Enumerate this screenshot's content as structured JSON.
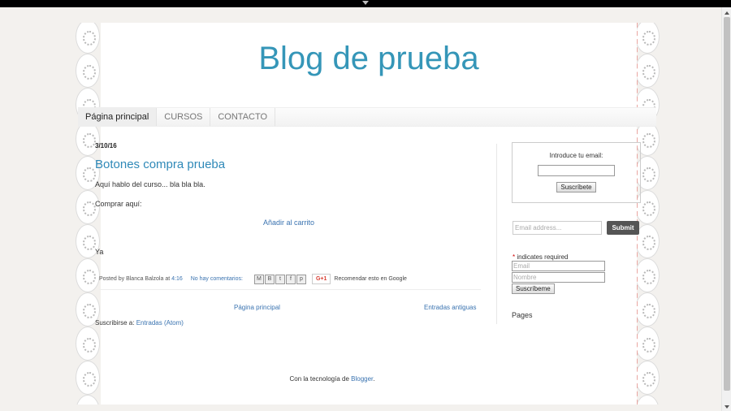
{
  "blog": {
    "title": "Blog de prueba"
  },
  "tabs": [
    {
      "label": "Página principal",
      "active": true
    },
    {
      "label": "CURSOS",
      "active": false
    },
    {
      "label": "CONTACTO",
      "active": false
    }
  ],
  "post": {
    "date": "3/10/16",
    "title": "Botones compra prueba",
    "paragraph1": "Aquí hablo del curso... bla bla bla.",
    "paragraph2": "Comprar aquí:",
    "cart_link": "Añadir al carrito",
    "paragraph3": "Ya",
    "posted_by": "Posted by Blanca Balzola at",
    "time": "4:16",
    "comments": "No hay comentarios:",
    "share_icons": [
      "email-icon",
      "blogger-icon",
      "twitter-icon",
      "facebook-icon",
      "pinterest-icon"
    ],
    "gplus_label": "G+1",
    "recommend": "Recomendar esto en Google"
  },
  "pager": {
    "home": "Página principal",
    "older": "Entradas antiguas"
  },
  "subscribe": {
    "prefix": "Suscribirse a:",
    "link": "Entradas (Atom)"
  },
  "sidebar": {
    "email_label": "Introduce tu email:",
    "email_button": "Suscríbete",
    "mc_placeholder": "Email address...",
    "mc_submit": "Submit",
    "required_star": "*",
    "required_text": "indicates required",
    "email_placeholder": "Email",
    "name_placeholder": "Nombre",
    "subscribe_button": "Suscríbeme",
    "pages_heading": "Pages"
  },
  "footer": {
    "prefix": "Con la tecnología de",
    "link": "Blogger",
    "suffix": "."
  },
  "colors": {
    "title": "#3596b8",
    "link": "#3a73b0",
    "stitch": "#e9a6a1"
  }
}
